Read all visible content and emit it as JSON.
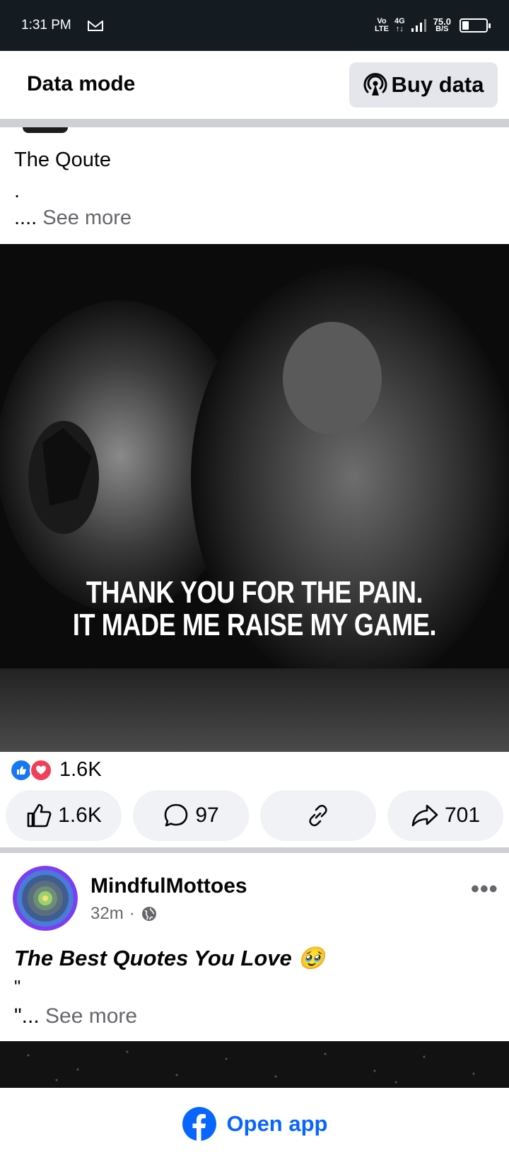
{
  "status_bar": {
    "time": "1:31 PM",
    "mail_icon": "gmail-icon",
    "volte_top": "Vo",
    "volte_bottom": "LTE",
    "network": "4G",
    "speed_value": "75.0",
    "speed_unit": "B/S",
    "battery_level": "1"
  },
  "top_bar": {
    "title": "Data mode",
    "buy_data_label": "Buy data",
    "buy_data_icon": "broadcast-icon"
  },
  "post1": {
    "text_line1": "The Qoute",
    "text_line2": ".",
    "text_prefix": "....",
    "see_more": "See more",
    "image_quote_line1": "THANK YOU FOR THE PAIN.",
    "image_quote_line2": "IT MADE ME RAISE MY GAME.",
    "reactions_count": "1.6K",
    "like_count": "1.6K",
    "comment_count": "97",
    "share_count": "701"
  },
  "post2": {
    "author": "MindfulMottoes",
    "time": "32m",
    "separator": "·",
    "privacy_icon": "globe-icon",
    "title": "The Best Quotes You Love 🥹",
    "quote_line": "\"",
    "see_more_prefix": "\"...",
    "see_more": "See more"
  },
  "footer": {
    "open_app_label": "Open app",
    "brand_color": "#0866ff"
  }
}
